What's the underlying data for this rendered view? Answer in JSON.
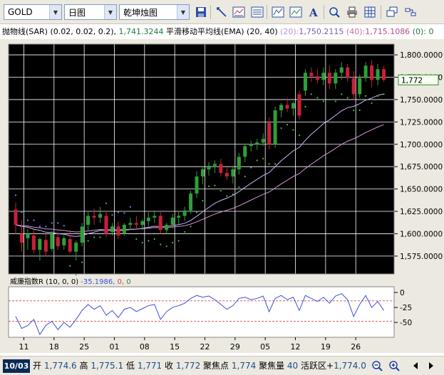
{
  "toolbar": {
    "symbol": "GOLD",
    "period": "日图",
    "chart_style": "乾坤烛图",
    "icons": [
      "save-icon",
      "line-tool-icon",
      "chart-type-icon",
      "data-window-icon",
      "indicator-icon",
      "indicator-edit-icon",
      "text-icon",
      "zoom-icon",
      "print-icon",
      "grid-icon",
      "new-window-icon",
      "link-icon"
    ]
  },
  "indicators_line": {
    "sar_label": "抛物线(SAR)",
    "sar_params": "(0.02, 0.02, 0.2)",
    "sar_value": "1,741.3244",
    "ema_label": "平滑移动平均线(EMA)",
    "ema_params": "(20, 40)",
    "ema20_label": "(20):",
    "ema20_value": "1,750.2115",
    "ema40_label": "(40):",
    "ema40_value": "1,715.1086",
    "extra": "(0): 0"
  },
  "colors": {
    "background": "#000000",
    "grid": "#ffffff",
    "candle_up": "#2f9e3a",
    "candle_down": "#c8203a",
    "sar": "#5a8cff",
    "ema20": "#c9b7ff",
    "ema40": "#d596d8",
    "williams": "#3a4fd8",
    "level_line": "#d66060",
    "current_label": "#2e8b2e"
  },
  "price_axis": {
    "ticks": [
      "1,800.0000",
      "1,775.0000",
      "1,750.0000",
      "1,725.0000",
      "1,700.0000",
      "1,675.0000",
      "1,650.0000",
      "1,625.0000",
      "1,600.0000",
      "1,575.0000"
    ],
    "current": "1,772"
  },
  "x_axis": {
    "labels": [
      "11",
      "18",
      "25",
      "01",
      "08",
      "15",
      "22",
      "29",
      "05",
      "12",
      "19",
      "26"
    ]
  },
  "sub_indicator": {
    "title": "威廉指数R",
    "params": "(10, 0, 0)",
    "value": "-35.1986",
    "v2": "0",
    "v3": "0",
    "ticks": [
      "0",
      "-25",
      "-50"
    ]
  },
  "status": {
    "date": "10/03",
    "open_label": "开",
    "open": "1,774.6",
    "high_label": "高",
    "high": "1,775.1",
    "low_label": "低",
    "low": "1,771",
    "close_label": "收",
    "close": "1,772",
    "focus_label": "聚焦点",
    "focus": "1,774",
    "volume_label": "聚焦量",
    "volume": "40",
    "active_label": "活跃区+",
    "active": "1,774.0"
  },
  "chart_data": {
    "type": "candlestick",
    "ylim": [
      1555,
      1812
    ],
    "candles": [
      [
        1627,
        1635,
        1600,
        1610
      ],
      [
        1600,
        1615,
        1580,
        1590
      ],
      [
        1595,
        1605,
        1582,
        1600
      ],
      [
        1598,
        1604,
        1578,
        1582
      ],
      [
        1582,
        1596,
        1570,
        1594
      ],
      [
        1593,
        1600,
        1575,
        1580
      ],
      [
        1583,
        1603,
        1580,
        1600
      ],
      [
        1596,
        1602,
        1582,
        1586
      ],
      [
        1587,
        1598,
        1582,
        1595
      ],
      [
        1594,
        1604,
        1578,
        1580
      ],
      [
        1580,
        1592,
        1570,
        1590
      ],
      [
        1590,
        1612,
        1586,
        1608
      ],
      [
        1610,
        1625,
        1604,
        1620
      ],
      [
        1620,
        1628,
        1610,
        1618
      ],
      [
        1618,
        1630,
        1612,
        1622
      ],
      [
        1620,
        1626,
        1596,
        1600
      ],
      [
        1602,
        1612,
        1598,
        1608
      ],
      [
        1608,
        1614,
        1594,
        1598
      ],
      [
        1600,
        1612,
        1598,
        1610
      ],
      [
        1610,
        1618,
        1604,
        1612
      ],
      [
        1612,
        1620,
        1606,
        1610
      ],
      [
        1610,
        1616,
        1604,
        1614
      ],
      [
        1614,
        1624,
        1608,
        1618
      ],
      [
        1618,
        1626,
        1612,
        1620
      ],
      [
        1620,
        1624,
        1600,
        1604
      ],
      [
        1604,
        1612,
        1600,
        1610
      ],
      [
        1610,
        1622,
        1606,
        1618
      ],
      [
        1618,
        1624,
        1610,
        1620
      ],
      [
        1620,
        1630,
        1614,
        1626
      ],
      [
        1626,
        1648,
        1622,
        1645
      ],
      [
        1645,
        1670,
        1640,
        1664
      ],
      [
        1664,
        1675,
        1655,
        1672
      ],
      [
        1672,
        1680,
        1665,
        1676
      ],
      [
        1676,
        1682,
        1668,
        1678
      ],
      [
        1678,
        1684,
        1664,
        1668
      ],
      [
        1668,
        1674,
        1660,
        1664
      ],
      [
        1664,
        1676,
        1656,
        1672
      ],
      [
        1672,
        1690,
        1666,
        1686
      ],
      [
        1686,
        1700,
        1680,
        1698
      ],
      [
        1698,
        1704,
        1692,
        1700
      ],
      [
        1700,
        1706,
        1694,
        1702
      ],
      [
        1702,
        1712,
        1698,
        1706
      ],
      [
        1724,
        1730,
        1694,
        1700
      ],
      [
        1700,
        1742,
        1696,
        1738
      ],
      [
        1738,
        1746,
        1730,
        1744
      ],
      [
        1744,
        1752,
        1736,
        1740
      ],
      [
        1740,
        1748,
        1732,
        1746
      ],
      [
        1756,
        1760,
        1728,
        1732
      ],
      [
        1760,
        1784,
        1754,
        1780
      ],
      [
        1780,
        1786,
        1770,
        1776
      ],
      [
        1776,
        1784,
        1768,
        1772
      ],
      [
        1772,
        1786,
        1766,
        1780
      ],
      [
        1780,
        1788,
        1762,
        1768
      ],
      [
        1768,
        1784,
        1762,
        1780
      ],
      [
        1780,
        1792,
        1772,
        1786
      ],
      [
        1786,
        1790,
        1770,
        1774
      ],
      [
        1774,
        1782,
        1750,
        1756
      ],
      [
        1756,
        1778,
        1752,
        1774
      ],
      [
        1774,
        1792,
        1770,
        1788
      ],
      [
        1788,
        1794,
        1764,
        1772
      ],
      [
        1772,
        1790,
        1766,
        1784
      ],
      [
        1784,
        1788,
        1770,
        1772
      ]
    ],
    "williams": [
      -40,
      -60,
      -55,
      -45,
      -70,
      -55,
      -48,
      -62,
      -50,
      -58,
      -45,
      -30,
      -20,
      -28,
      -22,
      -38,
      -30,
      -42,
      -28,
      -25,
      -32,
      -27,
      -22,
      -20,
      -45,
      -32,
      -25,
      -22,
      -18,
      -10,
      -5,
      -8,
      -6,
      -12,
      -20,
      -28,
      -22,
      -10,
      -8,
      -12,
      -10,
      -6,
      -32,
      -10,
      -5,
      -12,
      -8,
      -30,
      -5,
      -10,
      -15,
      -8,
      -18,
      -6,
      -2,
      -12,
      -40,
      -20,
      -5,
      -25,
      -15,
      -30
    ]
  }
}
